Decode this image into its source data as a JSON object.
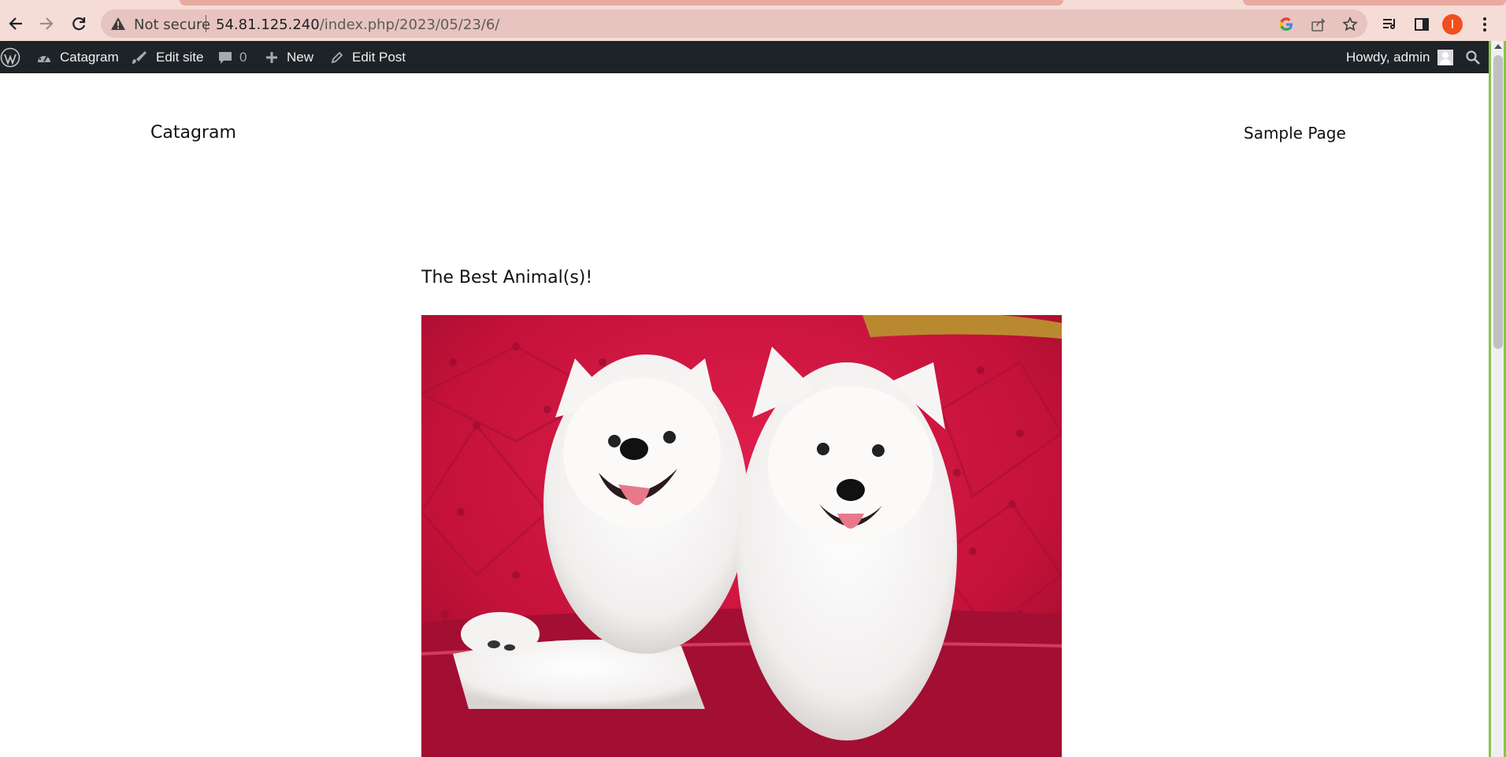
{
  "browser": {
    "omnibox": {
      "security_label": "Not secure",
      "url_host": "54.81.125.240",
      "url_path": "/index.php/2023/05/23/6/"
    },
    "profile_initial": "I",
    "colors": {
      "chrome": "#f6dcd6",
      "omnibox": "#e7c4bf",
      "profile": "#f24e1e"
    }
  },
  "admin_bar": {
    "site_name": "Catagram",
    "edit_site": "Edit site",
    "comments_count": "0",
    "new_label": "New",
    "edit_post": "Edit Post",
    "greeting": "Howdy, admin",
    "background": "#1d2327"
  },
  "site": {
    "title": "Catagram",
    "nav": [
      "Sample Page"
    ]
  },
  "post": {
    "title": "The Best Animal(s)!"
  }
}
